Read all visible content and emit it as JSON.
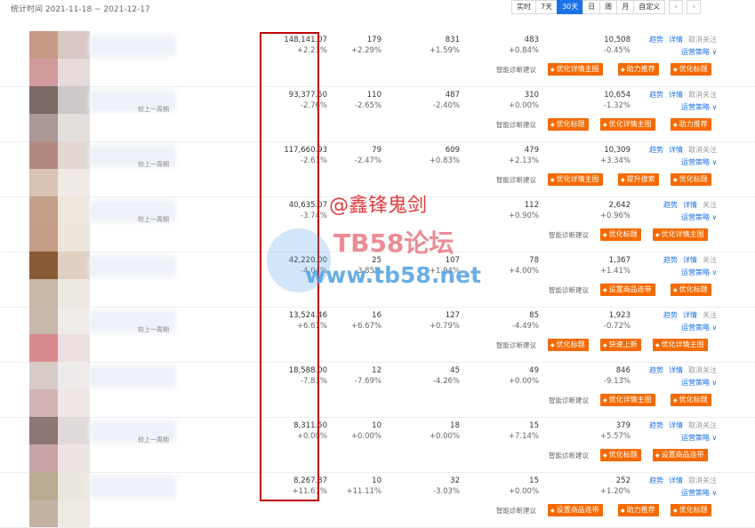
{
  "header": {
    "stat_period": "统计时间 2021-11-18 ~ 2021-12-17",
    "range_buttons": [
      "实时",
      "7天",
      "30天",
      "日",
      "周",
      "月",
      "自定义"
    ],
    "active_range": "30天",
    "prev_icon": "chevron-left-icon",
    "next_icon": "chevron-right-icon"
  },
  "labels": {
    "compare": "较上一周期",
    "trend": "趋势",
    "detail": "详情",
    "unfollow": "取消关注",
    "follow": "关注",
    "strategy": "运营策略 ∨",
    "suggestion": "智能诊断建议"
  },
  "rows": [
    {
      "col1": "148,141.07",
      "col1d": "+2.23%",
      "col2": "179",
      "col2d": "+2.29%",
      "col3": "831",
      "col3d": "+1.59%",
      "col4": "483",
      "col4d": "+0.84%",
      "col5": "10,508",
      "col5d": "-0.45%",
      "followed": true,
      "show_compare": false,
      "tags": [
        "优化详情主图",
        "助力推荐",
        "优化标题"
      ]
    },
    {
      "col1": "93,377.50",
      "col1d": "-2.76%",
      "col2": "110",
      "col2d": "-2.65%",
      "col3": "487",
      "col3d": "-2.40%",
      "col4": "310",
      "col4d": "+0.00%",
      "col5": "10,654",
      "col5d": "-1.32%",
      "followed": true,
      "show_compare": true,
      "tags": [
        "优化标题",
        "优化详情主图",
        "助力推荐"
      ]
    },
    {
      "col1": "117,660.93",
      "col1d": "-2.61%",
      "col2": "79",
      "col2d": "-2.47%",
      "col3": "609",
      "col3d": "+0.83%",
      "col4": "479",
      "col4d": "+2.13%",
      "col5": "10,309",
      "col5d": "+3.34%",
      "followed": true,
      "show_compare": true,
      "tags": [
        "优化详情主图",
        "提升搜索",
        "优化标题"
      ]
    },
    {
      "col1": "40,635.07",
      "col1d": "-3.74%",
      "col2": "",
      "col2d": "",
      "col3": "",
      "col3d": "",
      "col4": "112",
      "col4d": "+0.90%",
      "col5": "2,642",
      "col5d": "+0.96%",
      "followed": false,
      "show_compare": true,
      "tags": [
        "优化标题",
        "优化详情主图"
      ]
    },
    {
      "col1": "42,220.00",
      "col1d": "-4.04%",
      "col2": "25",
      "col2d": "-3.85%",
      "col3": "107",
      "col3d": "+1.94%",
      "col4": "78",
      "col4d": "+4.00%",
      "col5": "1,367",
      "col5d": "+1.41%",
      "followed": false,
      "show_compare": false,
      "tags": [
        "设置商品连带",
        "优化标题"
      ]
    },
    {
      "col1": "13,524.46",
      "col1d": "+6.61%",
      "col2": "16",
      "col2d": "+6.67%",
      "col3": "127",
      "col3d": "+0.79%",
      "col4": "85",
      "col4d": "-4.49%",
      "col5": "1,923",
      "col5d": "-0.72%",
      "followed": false,
      "show_compare": true,
      "tags": [
        "优化标题",
        "快速上新",
        "优化详情主图"
      ]
    },
    {
      "col1": "18,588.00",
      "col1d": "-7.83%",
      "col2": "12",
      "col2d": "-7.69%",
      "col3": "45",
      "col3d": "-4.26%",
      "col4": "49",
      "col4d": "+0.00%",
      "col5": "846",
      "col5d": "-9.13%",
      "followed": true,
      "show_compare": false,
      "tags": [
        "优化详情主图",
        "优化标题"
      ]
    },
    {
      "col1": "8,311.50",
      "col1d": "+0.00%",
      "col2": "10",
      "col2d": "+0.00%",
      "col3": "18",
      "col3d": "+0.00%",
      "col4": "15",
      "col4d": "+7.14%",
      "col5": "379",
      "col5d": "+5.57%",
      "followed": true,
      "show_compare": true,
      "tags": [
        "优化标题",
        "设置商品连带"
      ]
    },
    {
      "col1": "8,267.87",
      "col1d": "+11.61%",
      "col2": "10",
      "col2d": "+11.11%",
      "col3": "32",
      "col3d": "-3.03%",
      "col4": "15",
      "col4d": "+0.00%",
      "col5": "252",
      "col5d": "+1.20%",
      "followed": true,
      "show_compare": false,
      "tags": [
        "设置商品连带",
        "助力推荐",
        "优化标题"
      ]
    }
  ],
  "watermark": {
    "handle": "@鑫锋鬼剑",
    "forum": "TB58论坛",
    "url": "www.tb58.net"
  },
  "colors": {
    "accent_blue": "#1a73e8",
    "tag_orange": "#f56a00",
    "highlight_red": "#c00000"
  },
  "thumb_colors": [
    [
      "#c79a86",
      "#d9c7c4"
    ],
    [
      "#7a6a66",
      "#cfc9c9"
    ],
    [
      "#b08a80",
      "#e3d7d2"
    ],
    [
      "#c4a088",
      "#efe6dd"
    ],
    [
      "#8a5a34",
      "#e0d0c2"
    ],
    [
      "#c9b8ae",
      "#efebe7"
    ],
    [
      "#d8ccc8",
      "#efeaea"
    ],
    [
      "#8c7673",
      "#e0dada"
    ],
    [
      "#b9aa92",
      "#ece7de"
    ]
  ],
  "thumb_colors_b": [
    [
      "#d29a9c",
      "#e6dada"
    ],
    [
      "#aa9996",
      "#e3dfdd"
    ],
    [
      "#d9c3b4",
      "#efeae5"
    ],
    [
      "#c49f86",
      "#eee6dd"
    ],
    [
      "#c9b7a7",
      "#eee8e2"
    ],
    [
      "#d78b8e",
      "#ecdfdf"
    ],
    [
      "#d2b5b4",
      "#efe6e6"
    ],
    [
      "#c8a3a6",
      "#eee4e4"
    ],
    [
      "#c2b3a3",
      "#eee9e3"
    ]
  ]
}
